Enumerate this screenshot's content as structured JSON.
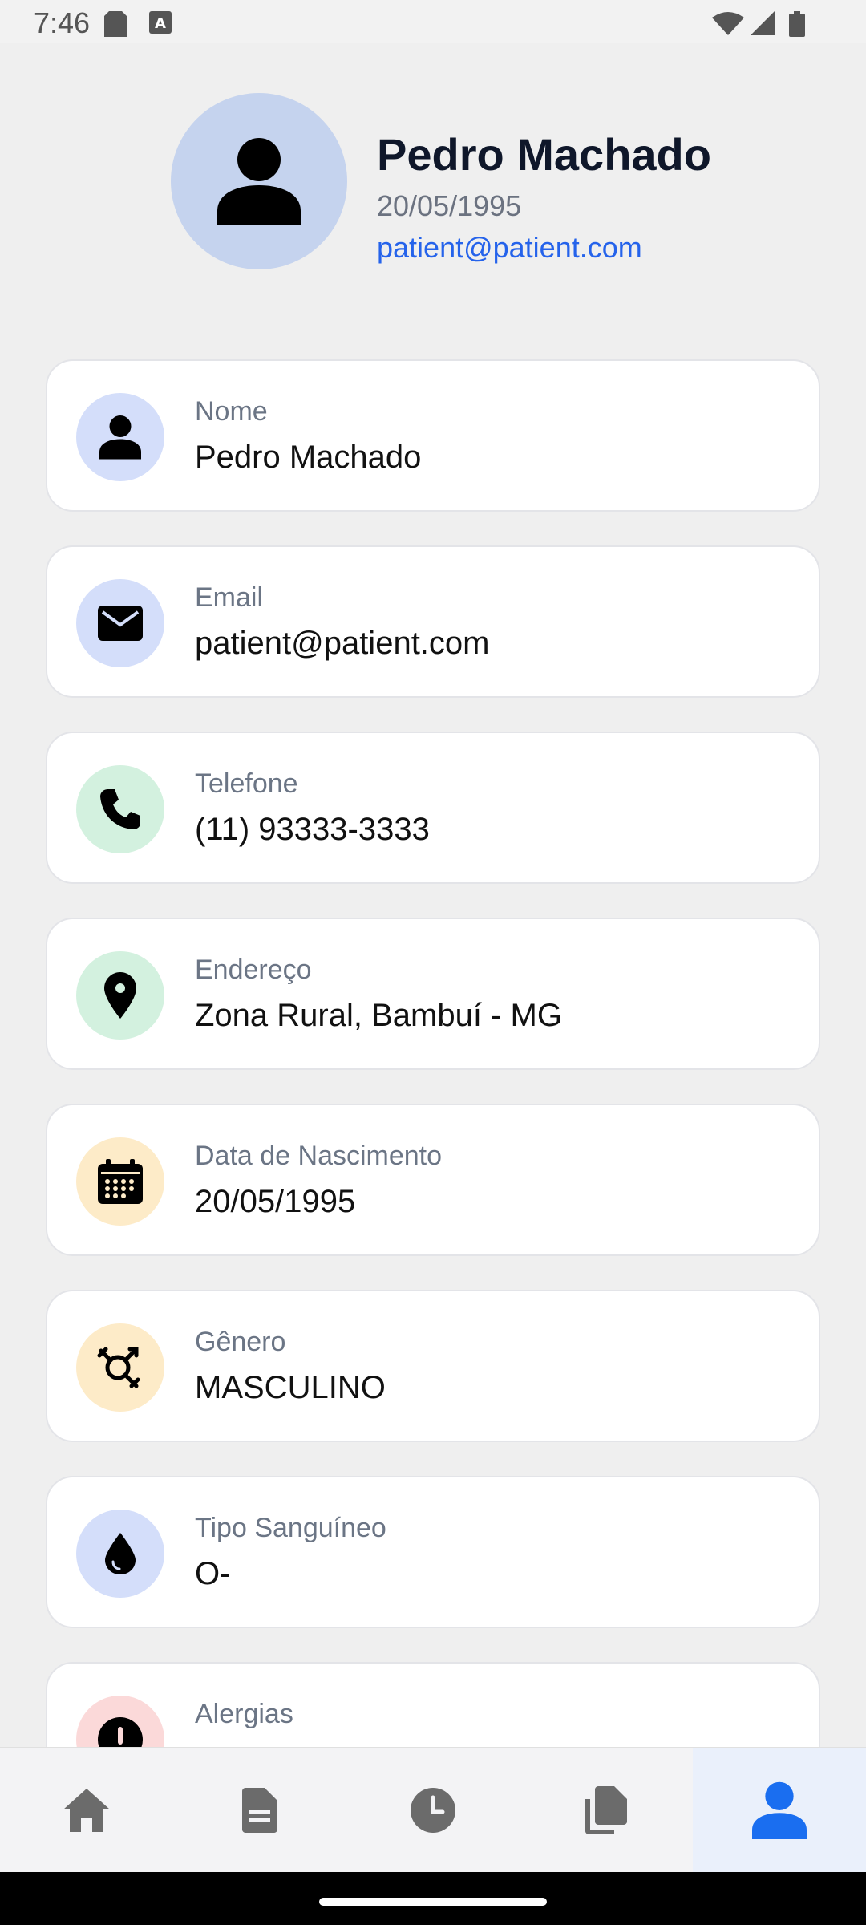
{
  "status_bar": {
    "time": "7:46"
  },
  "profile": {
    "name": "Pedro Machado",
    "dob": "20/05/1995",
    "email": "patient@patient.com"
  },
  "fields": [
    {
      "label": "Nome",
      "value": "Pedro Machado",
      "icon": "person-icon",
      "icon_bg": "#d4defa"
    },
    {
      "label": "Email",
      "value": "patient@patient.com",
      "icon": "envelope-icon",
      "icon_bg": "#d4defa"
    },
    {
      "label": "Telefone",
      "value": "(11) 93333-3333",
      "icon": "phone-icon",
      "icon_bg": "#d3f1df"
    },
    {
      "label": "Endereço",
      "value": "Zona Rural, Bambuí - MG",
      "icon": "location-pin-icon",
      "icon_bg": "#d3f1df"
    },
    {
      "label": "Data de Nascimento",
      "value": "20/05/1995",
      "icon": "calendar-icon",
      "icon_bg": "#fdebc8"
    },
    {
      "label": "Gênero",
      "value": "MASCULINO",
      "icon": "gender-icon",
      "icon_bg": "#fdebc8"
    },
    {
      "label": "Tipo Sanguíneo",
      "value": "O-",
      "icon": "blood-drop-icon",
      "icon_bg": "#d4defa"
    },
    {
      "label": "Alergias",
      "value": "",
      "icon": "alert-icon",
      "icon_bg": "#fbd9d9"
    }
  ],
  "nav": {
    "items": [
      "home-icon",
      "document-icon",
      "clock-icon",
      "documents-icon",
      "profile-icon"
    ],
    "active_index": 4,
    "active_color": "#1a6ef0",
    "inactive_color": "#6b6b6b"
  }
}
